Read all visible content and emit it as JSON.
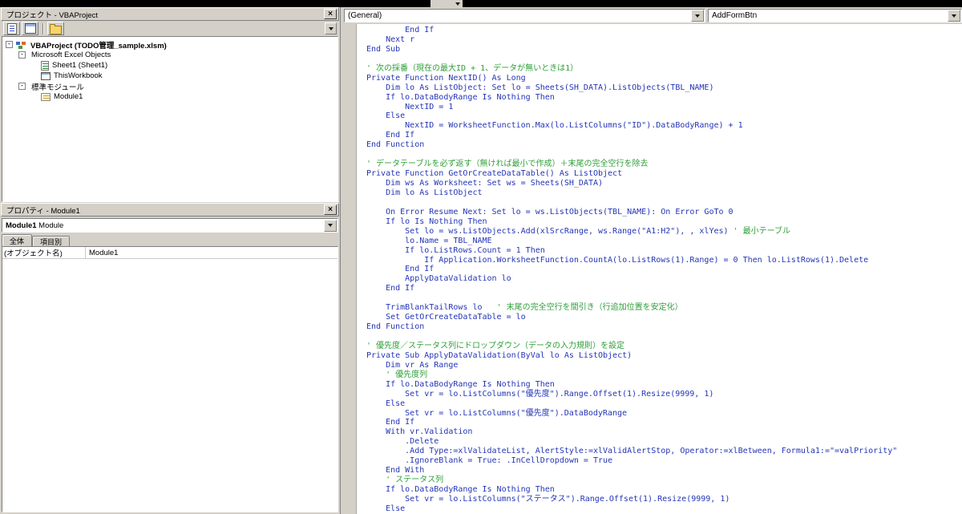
{
  "colors": {
    "chrome": "#d4d0c8",
    "code_text": "#2435b5",
    "comment_text": "#2f9e3a"
  },
  "project_panel": {
    "title": "プロジェクト - VBAProject",
    "tree": [
      {
        "label": "VBAProject (TODO管理_sample.xlsm)",
        "level": 0,
        "bold": true,
        "expander": "-",
        "icon": "project-icon"
      },
      {
        "label": "Microsoft Excel Objects",
        "level": 1,
        "expander": "-",
        "icon": "folder-icon"
      },
      {
        "label": "Sheet1 (Sheet1)",
        "level": 2,
        "icon": "sheet-icon"
      },
      {
        "label": "ThisWorkbook",
        "level": 2,
        "icon": "workbook-icon"
      },
      {
        "label": "標準モジュール",
        "level": 1,
        "expander": "-",
        "icon": "folder-icon"
      },
      {
        "label": "Module1",
        "level": 2,
        "icon": "module-icon"
      }
    ]
  },
  "properties_panel": {
    "title": "プロパティ - Module1",
    "object_name": "Module1",
    "object_type": "Module",
    "tabs": [
      {
        "id": "alphabetic",
        "label": "全体",
        "active": true
      },
      {
        "id": "categorized",
        "label": "項目別",
        "active": false
      }
    ],
    "rows": [
      {
        "name": "(オブジェクト名)",
        "value": "Module1"
      }
    ]
  },
  "code_pane": {
    "object_dropdown": "(General)",
    "procedure_dropdown": "AddFormBtn",
    "lines": [
      "        End If",
      "    Next r",
      "End Sub",
      "",
      "' 次の採番（現在の最大ID + 1、データが無いときは1）",
      "Private Function NextID() As Long",
      "    Dim lo As ListObject: Set lo = Sheets(SH_DATA).ListObjects(TBL_NAME)",
      "    If lo.DataBodyRange Is Nothing Then",
      "        NextID = 1",
      "    Else",
      "        NextID = WorksheetFunction.Max(lo.ListColumns(\"ID\").DataBodyRange) + 1",
      "    End If",
      "End Function",
      "",
      "' データテーブルを必ず返す（無ければ最小で作成）＋末尾の完全空行を除去",
      "Private Function GetOrCreateDataTable() As ListObject",
      "    Dim ws As Worksheet: Set ws = Sheets(SH_DATA)",
      "    Dim lo As ListObject",
      "",
      "    On Error Resume Next: Set lo = ws.ListObjects(TBL_NAME): On Error GoTo 0",
      "    If lo Is Nothing Then",
      "        Set lo = ws.ListObjects.Add(xlSrcRange, ws.Range(\"A1:H2\"), , xlYes) ' 最小テーブル",
      "        lo.Name = TBL_NAME",
      "        If lo.ListRows.Count = 1 Then",
      "            If Application.WorksheetFunction.CountA(lo.ListRows(1).Range) = 0 Then lo.ListRows(1).Delete",
      "        End If",
      "        ApplyDataValidation lo",
      "    End If",
      "",
      "    TrimBlankTailRows lo   ' 末尾の完全空行を間引き（行追加位置を安定化）",
      "    Set GetOrCreateDataTable = lo",
      "End Function",
      "",
      "' 優先度／ステータス列にドロップダウン（データの入力規則）を設定",
      "Private Sub ApplyDataValidation(ByVal lo As ListObject)",
      "    Dim vr As Range",
      "    ' 優先度列",
      "    If lo.DataBodyRange Is Nothing Then",
      "        Set vr = lo.ListColumns(\"優先度\").Range.Offset(1).Resize(9999, 1)",
      "    Else",
      "        Set vr = lo.ListColumns(\"優先度\").DataBodyRange",
      "    End If",
      "    With vr.Validation",
      "        .Delete",
      "        .Add Type:=xlValidateList, AlertStyle:=xlValidAlertStop, Operator:=xlBetween, Formula1:=\"=valPriority\"",
      "        .IgnoreBlank = True: .InCellDropdown = True",
      "    End With",
      "    ' ステータス列",
      "    If lo.DataBodyRange Is Nothing Then",
      "        Set vr = lo.ListColumns(\"ステータス\").Range.Offset(1).Resize(9999, 1)",
      "    Else"
    ]
  }
}
